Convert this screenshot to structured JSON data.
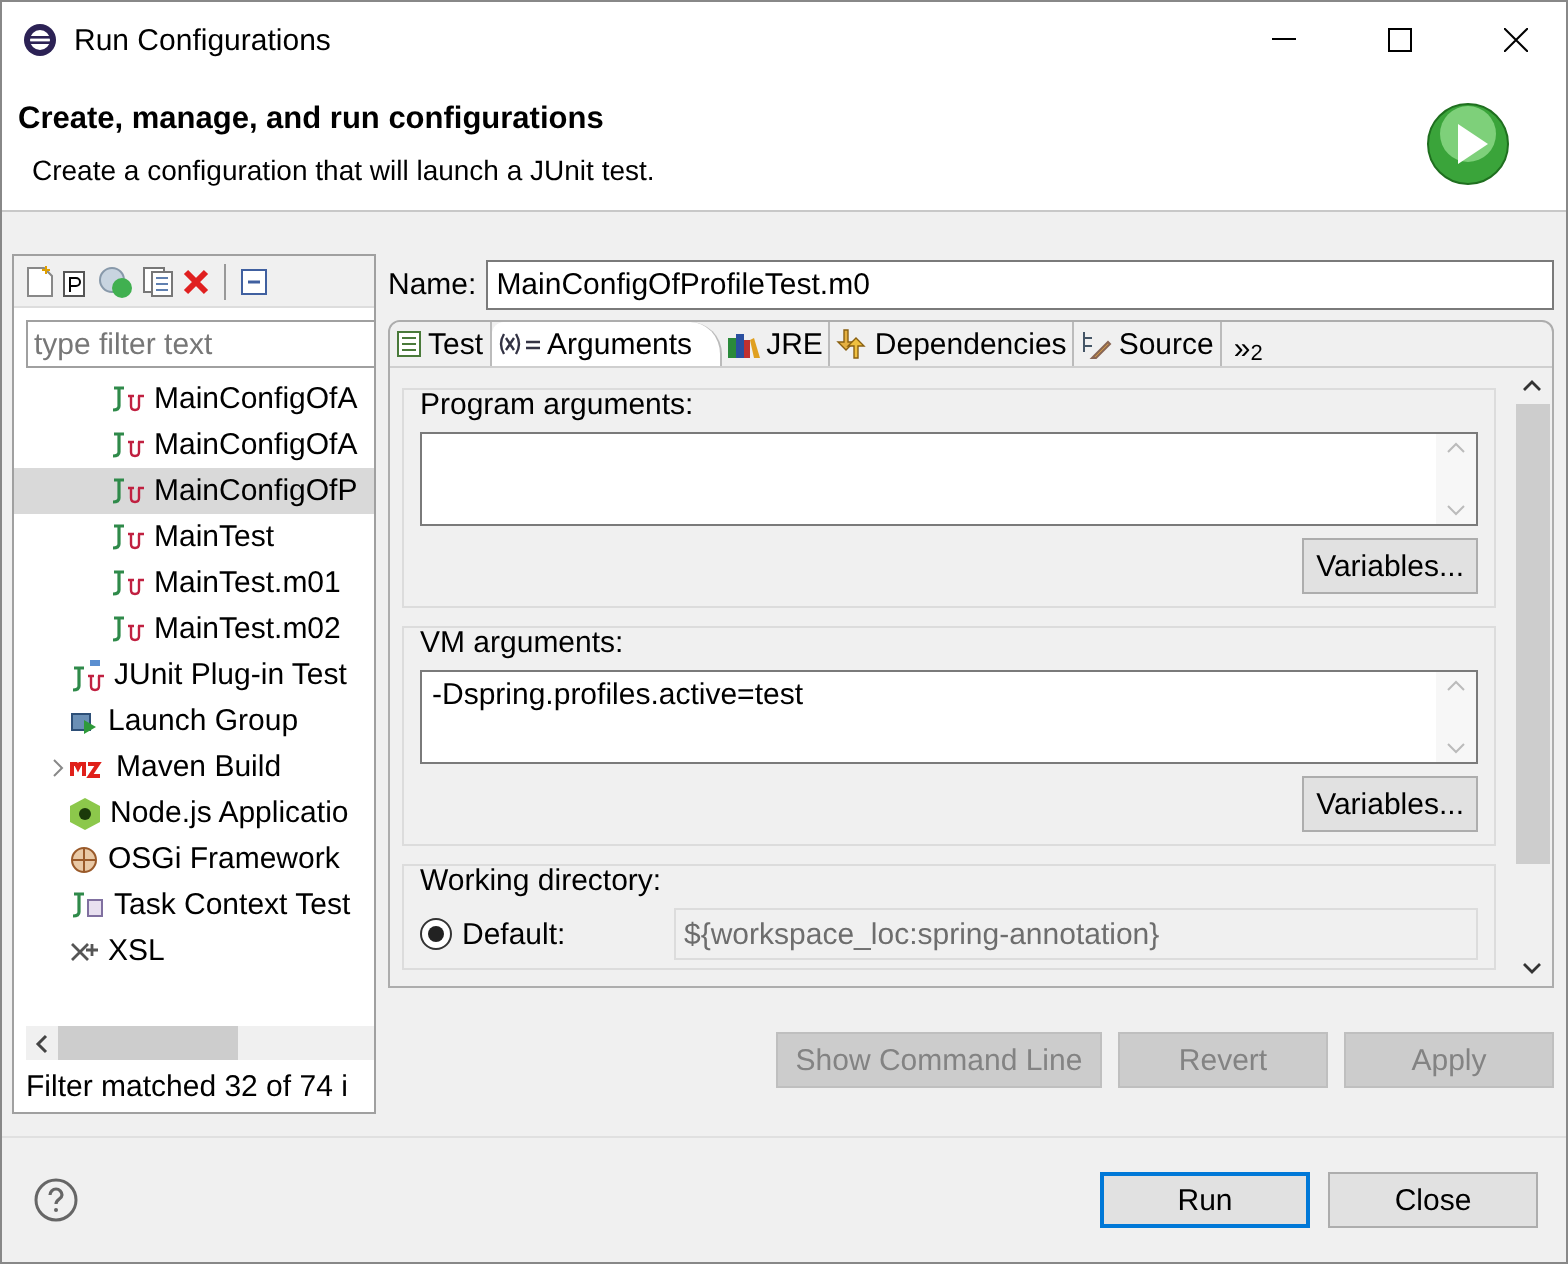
{
  "window": {
    "title": "Run Configurations"
  },
  "header": {
    "title": "Create, manage, and run configurations",
    "subtitle": "Create a configuration that will launch a JUnit test."
  },
  "sidebar": {
    "filter": {
      "placeholder": "type filter text"
    },
    "nested_items": [
      {
        "label": "MainConfigOfA",
        "kind": "junit",
        "selected": false
      },
      {
        "label": "MainConfigOfA",
        "kind": "junit",
        "selected": false
      },
      {
        "label": "MainConfigOfP",
        "kind": "junit",
        "selected": true
      },
      {
        "label": "MainTest",
        "kind": "junit",
        "selected": false
      },
      {
        "label": "MainTest.m01",
        "kind": "junit",
        "selected": false
      },
      {
        "label": "MainTest.m02",
        "kind": "junit",
        "selected": false
      }
    ],
    "tree": [
      {
        "label": "JUnit Plug-in Test",
        "kind": "junit-plugin",
        "selected": false
      },
      {
        "label": "Launch Group",
        "kind": "launch-group",
        "selected": false
      },
      {
        "label": "Maven Build",
        "kind": "maven",
        "selected": false,
        "expanded": false
      },
      {
        "label": "Node.js Applicatio",
        "kind": "nodejs",
        "selected": false
      },
      {
        "label": "OSGi Framework",
        "kind": "osgi",
        "selected": false
      },
      {
        "label": "Task Context Test",
        "kind": "task-context",
        "selected": false
      },
      {
        "label": "XSL",
        "kind": "xsl",
        "selected": false
      }
    ],
    "status": "Filter matched 32 of 74 i"
  },
  "name_field": {
    "label": "Name:",
    "value": "MainConfigOfProfileTest.m0"
  },
  "tabs": [
    {
      "label": "Test",
      "kind": "test",
      "selected": false
    },
    {
      "label": "Arguments",
      "kind": "arguments",
      "selected": true
    },
    {
      "label": "JRE",
      "kind": "jre",
      "selected": false
    },
    {
      "label": "Dependencies",
      "kind": "dependencies",
      "selected": false
    },
    {
      "label": "Source",
      "kind": "source",
      "selected": false
    }
  ],
  "more_tabs": {
    "label": "»",
    "count": "2"
  },
  "program_arguments": {
    "label": "Program arguments:",
    "button": "Variables..."
  },
  "vm_arguments": {
    "label": "VM arguments:",
    "value": "-Dspring.profiles.active=test",
    "button": "Variables..."
  },
  "working_directory": {
    "label": "Working directory:",
    "options": [
      {
        "label": "Default:",
        "value": "${workspace_loc:spring-annotation}",
        "selected": true,
        "field_disabled": true
      }
    ]
  },
  "action_buttons": [
    {
      "label": "Show Command Line",
      "disabled": true
    },
    {
      "label": "Revert",
      "disabled": true
    },
    {
      "label": "Apply",
      "disabled": true
    }
  ],
  "footer_buttons": [
    {
      "label": "Run",
      "default": true
    },
    {
      "label": "Close",
      "default": false
    }
  ]
}
